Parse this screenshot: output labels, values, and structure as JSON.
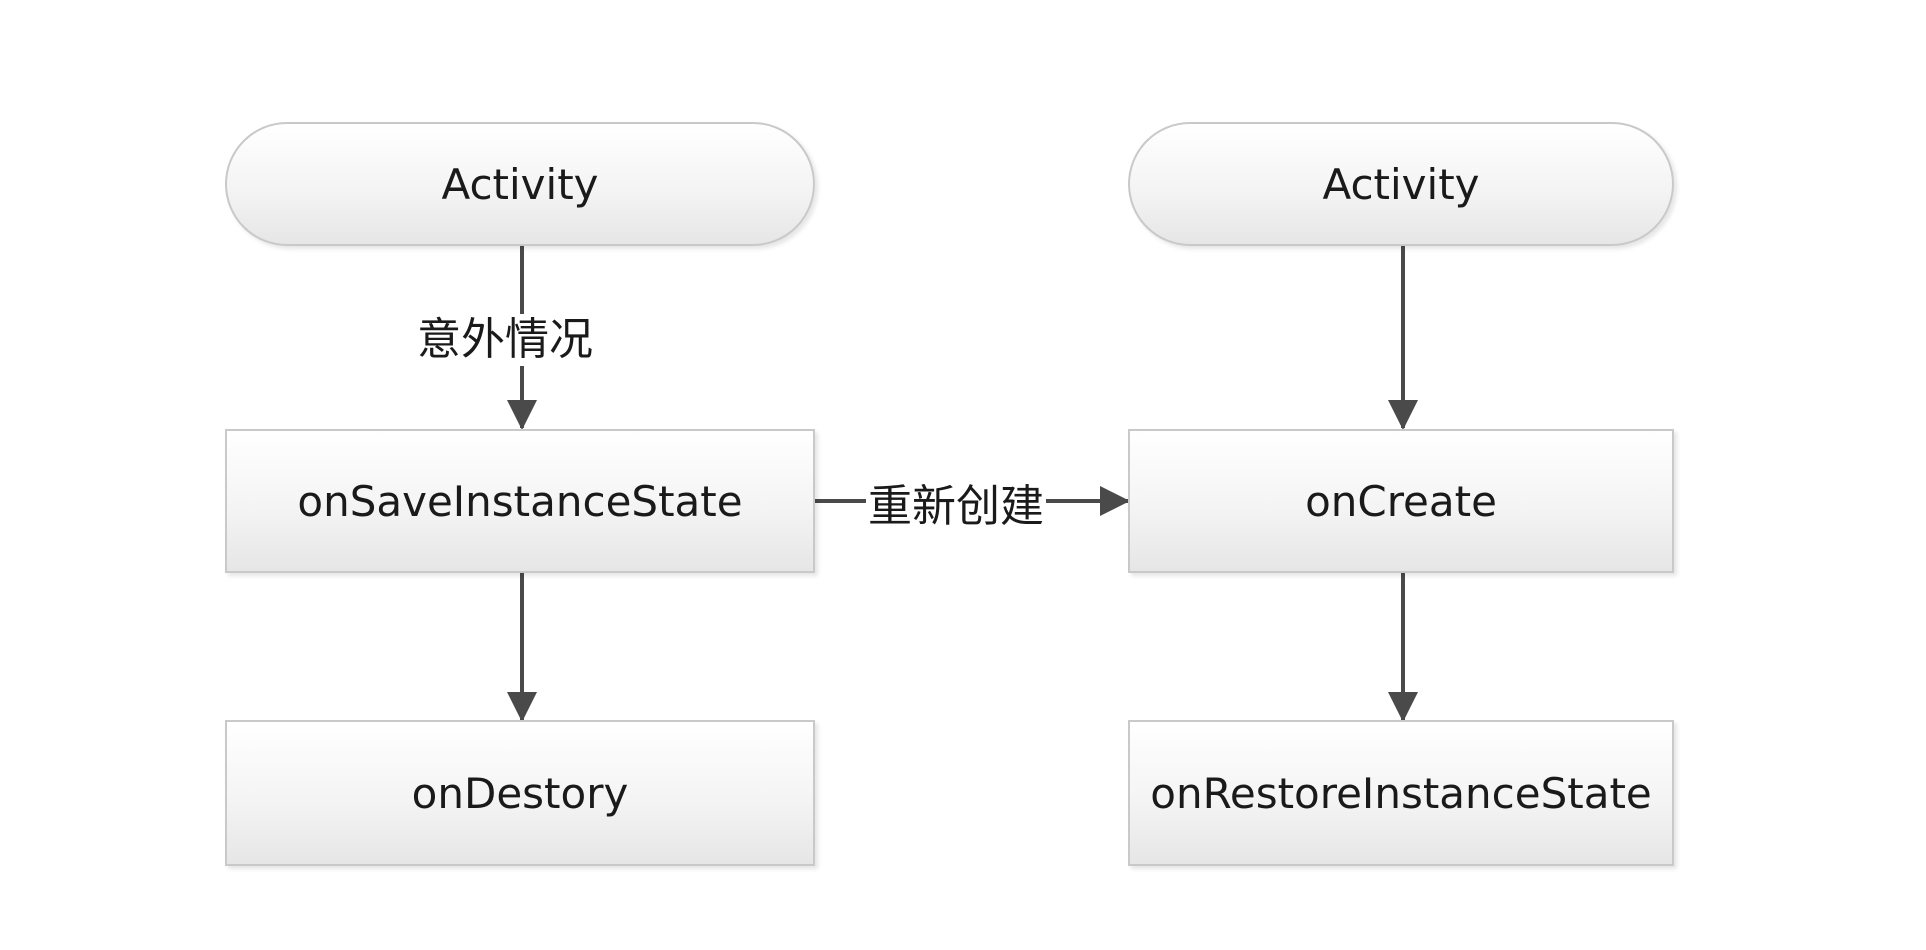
{
  "left_flow": {
    "start": "Activity",
    "save": "onSaveInstanceState",
    "destroy": "onDestory",
    "edge_label": "意外情况"
  },
  "right_flow": {
    "start": "Activity",
    "create": "onCreate",
    "restore": "onRestoreInstanceState"
  },
  "cross_edge_label": "重新创建",
  "colors": {
    "node_border": "#c9c9c9",
    "arrow": "#4a4a4a",
    "text": "#1a1a1a"
  }
}
